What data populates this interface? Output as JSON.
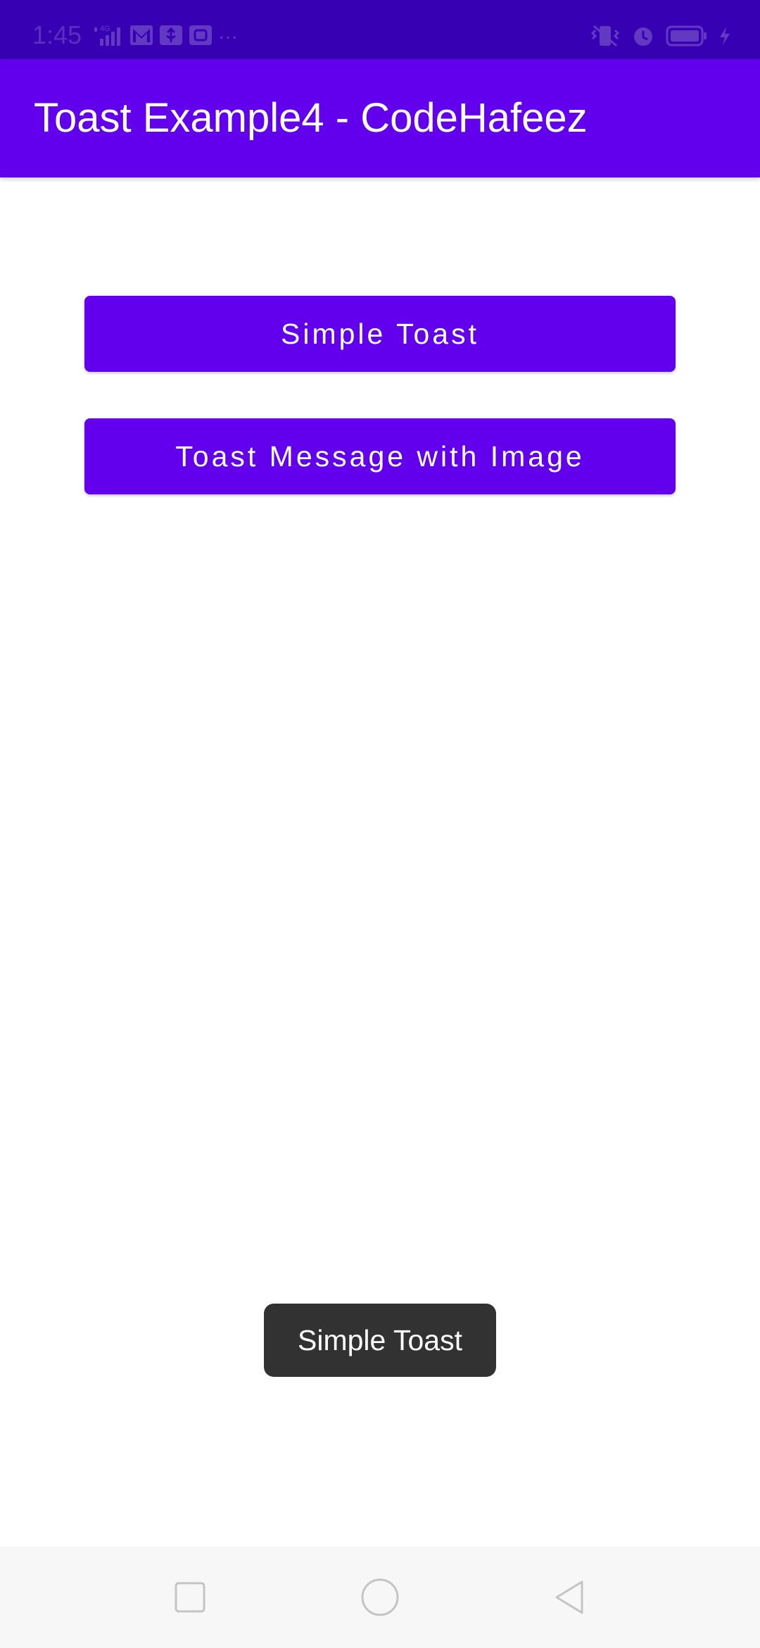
{
  "status_bar": {
    "time": "1:45",
    "network": "4G",
    "more": "···",
    "left_icons": [
      "signal-icon",
      "gmail-icon",
      "usb-icon",
      "app-icon"
    ],
    "right_icons": [
      "vibrate-icon",
      "alarm-icon",
      "battery-icon",
      "charging-icon"
    ]
  },
  "app_bar": {
    "title": "Toast Example4 - CodeHafeez"
  },
  "buttons": {
    "simple_toast": "Simple Toast",
    "toast_with_image": "Toast Message with Image"
  },
  "toast": {
    "text": "Simple Toast"
  },
  "nav_bar": {
    "icons": [
      "recent-apps-icon",
      "home-icon",
      "back-icon"
    ]
  },
  "colors": {
    "status_bar": "#3700b3",
    "primary": "#6200ee",
    "toast_bg": "#323232",
    "background": "#ffffff",
    "nav_bar": "#f7f7f7"
  }
}
